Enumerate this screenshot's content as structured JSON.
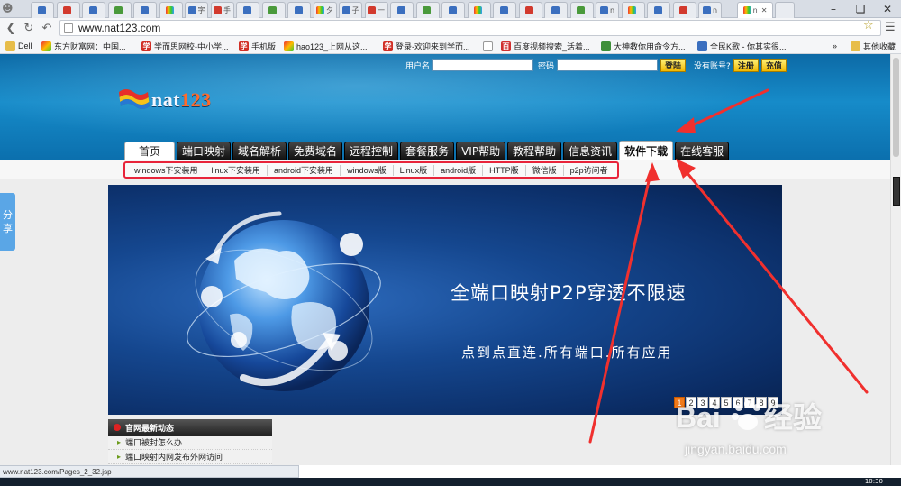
{
  "browser": {
    "tabs": [
      "",
      "",
      "",
      "",
      "",
      "",
      "字",
      "手",
      "",
      "",
      "",
      "夕",
      "子",
      "一",
      "",
      "",
      "",
      "",
      "",
      "",
      "",
      "",
      "n",
      "",
      "",
      "",
      "n"
    ],
    "active_tab_title": "n",
    "url": "www.nat123.com",
    "status_url": "www.nat123.com/Pages_2_32.jsp",
    "taskbar_time": "10:30"
  },
  "bookmarks": [
    {
      "label": "Dell",
      "icon": "folder-icon"
    },
    {
      "label": "东方财富网：中国...",
      "icon": "hao-icon"
    },
    {
      "label": "学而思网校-中小学...",
      "icon": "xue-icon"
    },
    {
      "label": "手机版",
      "icon": "xue-icon"
    },
    {
      "label": "hao123_上网从这...",
      "icon": "hao-icon"
    },
    {
      "label": "登录-欢迎来到学而...",
      "icon": "xue-icon"
    },
    {
      "label": "",
      "icon": "document-icon"
    },
    {
      "label": "百度视频搜索_活着...",
      "icon": "baidu-icon"
    },
    {
      "label": "大神教你用命令方...",
      "icon": "green-icon"
    },
    {
      "label": "全民K歌 - 你其实很...",
      "icon": "blue-icon"
    }
  ],
  "bookmarks_more": "»",
  "bookmarks_other": "其他收藏",
  "login": {
    "username_label": "用户名",
    "password_label": "密码",
    "login_button": "登陆",
    "no_account": "没有账号?",
    "register_button": "注册",
    "recharge_button": "充值"
  },
  "logo": {
    "text_a": "nat",
    "text_b": "123"
  },
  "main_nav": [
    {
      "label": "首页",
      "key": "home"
    },
    {
      "label": "端口映射",
      "key": "port-mapping"
    },
    {
      "label": "域名解析",
      "key": "dns"
    },
    {
      "label": "免费域名",
      "key": "free-domain"
    },
    {
      "label": "远程控制",
      "key": "remote-control"
    },
    {
      "label": "套餐服务",
      "key": "packages"
    },
    {
      "label": "VIP帮助",
      "key": "vip-help"
    },
    {
      "label": "教程帮助",
      "key": "tutorial"
    },
    {
      "label": "信息资讯",
      "key": "news"
    },
    {
      "label": "软件下载",
      "key": "software-download"
    },
    {
      "label": "在线客服",
      "key": "online-service"
    }
  ],
  "sub_nav": [
    "windows下安装用",
    "linux下安装用",
    "android下安装用",
    "windows版",
    "Linux版",
    "android版",
    "HTTP版",
    "微信版",
    "p2p访问者"
  ],
  "banner": {
    "title": "全端口映射P2P穿透不限速",
    "subtitle": "点到点直连.所有端口.所有应用",
    "pages": [
      "1",
      "2",
      "3",
      "4",
      "5",
      "6",
      "7",
      "8",
      "9"
    ]
  },
  "news": {
    "heading": "官网最新动态",
    "items": [
      "端口被封怎么办",
      "端口映射内网发布外网访问"
    ]
  },
  "share_tab": [
    "分",
    "享"
  ],
  "watermark": {
    "url": "jingyan.baidu.com"
  },
  "colors": {
    "header_blue": "#168bc9",
    "highlight_red": "#e8243a",
    "active_page": "#f07a1b"
  }
}
